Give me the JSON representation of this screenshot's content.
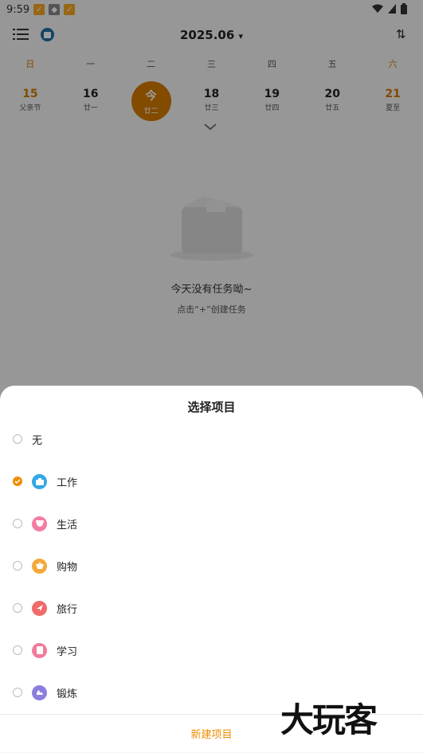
{
  "statusbar": {
    "time": "9:59"
  },
  "header": {
    "month": "2025.06",
    "dropdown_glyph": "▾",
    "sort_glyph": "⇅"
  },
  "week": {
    "days": [
      "日",
      "一",
      "二",
      "三",
      "四",
      "五",
      "六"
    ],
    "dates": [
      {
        "num": "15",
        "lunar": "父亲节"
      },
      {
        "num": "16",
        "lunar": "廿一"
      },
      {
        "num": "今",
        "lunar": "廿二"
      },
      {
        "num": "18",
        "lunar": "廿三"
      },
      {
        "num": "19",
        "lunar": "廿四"
      },
      {
        "num": "20",
        "lunar": "廿五"
      },
      {
        "num": "21",
        "lunar": "夏至"
      }
    ]
  },
  "empty": {
    "title": "今天没有任务呦~",
    "subtitle": "点击“+”创建任务"
  },
  "sheet": {
    "title": "选择项目",
    "options": [
      {
        "label": "无",
        "icon": "none",
        "checked": false
      },
      {
        "label": "工作",
        "icon": "briefcase-icon",
        "color": "#33a7e6",
        "checked": true
      },
      {
        "label": "生活",
        "icon": "cup-icon",
        "color": "#f47ca0",
        "checked": false
      },
      {
        "label": "购物",
        "icon": "basket-icon",
        "color": "#f4a93a",
        "checked": false
      },
      {
        "label": "旅行",
        "icon": "plane-icon",
        "color": "#f06a6a",
        "checked": false
      },
      {
        "label": "学习",
        "icon": "book-icon",
        "color": "#f27a9b",
        "checked": false
      },
      {
        "label": "锻炼",
        "icon": "dumbbell-icon",
        "color": "#8a7ee0",
        "checked": false
      }
    ],
    "new_button": "新建项目"
  },
  "watermark": "大玩客",
  "colors": {
    "accent": "#f08c00",
    "today": "#d27a00"
  }
}
